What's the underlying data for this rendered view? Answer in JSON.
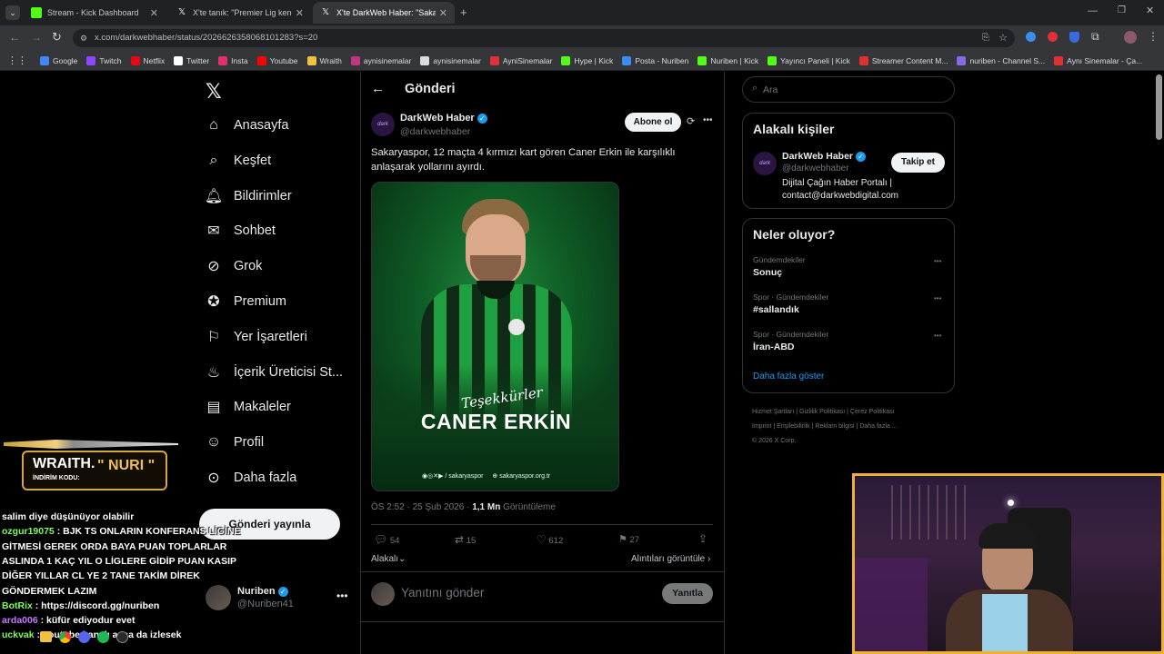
{
  "browser": {
    "tabs": [
      {
        "title": "Stream - Kick Dashboard",
        "active": false
      },
      {
        "title": "X'te tanık: \"Premier Lig kendi y",
        "active": false
      },
      {
        "title": "X'te DarkWeb Haber: \"Sakarya",
        "active": true
      }
    ],
    "url": "x.com/darkwebhaber/status/2026626358068101283?s=20",
    "bookmarks": [
      "Google",
      "Twitch",
      "Netflix",
      "Twitter",
      "Insta",
      "Youtube",
      "Wraith",
      "aynisinemalar",
      "aynisinemalar",
      "AyniSinemalar",
      "Hype | Kick",
      "Posta - Nuriben",
      "Nuriben | Kick",
      "Yayıncı Paneli | Kick",
      "Streamer Content M...",
      "nuriben - Channel S...",
      "Aynı Sinemalar - Ça..."
    ]
  },
  "sidebar": {
    "items": [
      {
        "label": "Anasayfa",
        "icon": "home-icon"
      },
      {
        "label": "Keşfet",
        "icon": "search-icon"
      },
      {
        "label": "Bildirimler",
        "icon": "bell-icon"
      },
      {
        "label": "Sohbet",
        "icon": "mail-icon"
      },
      {
        "label": "Grok",
        "icon": "grok-icon"
      },
      {
        "label": "Premium",
        "icon": "premium-icon"
      },
      {
        "label": "Yer İşaretleri",
        "icon": "bookmark-icon"
      },
      {
        "label": "İçerik Üreticisi St...",
        "icon": "creator-icon"
      },
      {
        "label": "Makaleler",
        "icon": "article-icon"
      },
      {
        "label": "Profil",
        "icon": "profile-icon"
      },
      {
        "label": "Daha fazla",
        "icon": "more-circle-icon"
      }
    ],
    "post_button": "Gönderi yayınla",
    "account": {
      "name": "Nuriben",
      "handle": "@Nuriben41"
    }
  },
  "post": {
    "header": "Gönderi",
    "author_name": "DarkWeb Haber",
    "author_handle": "@darkwebhaber",
    "subscribe_label": "Abone ol",
    "text": "Sakaryaspor, 12 maçta 4 kırmızı kart gören Caner Erkin ile karşılıklı anlaşarak yollarını ayırdı.",
    "image_script": "Teşekkürler",
    "image_name": "CANER ERKİN",
    "image_footer_left": "/ sakaryaspor",
    "image_footer_right": "sakaryaspor.org.tr",
    "timestamp": "ÖS 2:52 · 25 Şub 2026 ·",
    "views": "1,1 Mn",
    "views_label": "Görüntüleme",
    "stats": {
      "replies": "54",
      "reposts": "15",
      "likes": "612",
      "bookmarks": "27"
    },
    "sort_label": "Alakalı",
    "quotes_label": "Alıntıları görüntüle",
    "reply_placeholder": "Yanıtını gönder",
    "reply_button": "Yanıtla"
  },
  "right": {
    "search_placeholder": "Ara",
    "related_title": "Alakalı kişiler",
    "related_person": {
      "name": "DarkWeb Haber",
      "handle": "@darkwebhaber",
      "bio": "Dijital Çağın Haber Portalı | contact@darkwebdigital.com",
      "follow": "Takip et"
    },
    "trends_title": "Neler oluyor?",
    "trends": [
      {
        "context": "Gündemdekiler",
        "name": "Sonuç"
      },
      {
        "context": "Spor · Gündemdekiler",
        "name": "#sallandık"
      },
      {
        "context": "Spor · Gündemdekiler",
        "name": "İran-ABD"
      }
    ],
    "show_more": "Daha fazla göster",
    "footer_row1": [
      "Hizmet Şartları",
      "Gizlilik Politikası",
      "Çerez Politikası"
    ],
    "footer_row2": [
      "Imprint",
      "Erişilebilirlik",
      "Reklam bilgisi",
      "Daha fazla ..."
    ],
    "copyright": "© 2026 X Corp."
  },
  "overlay": {
    "sponsor_brand": "WRAITH.",
    "sponsor_code_label": "İNDİRİM KODU:",
    "sponsor_code": "\" NURI \"",
    "chat": [
      {
        "user": "",
        "text": "salim diye düşünüyor olabilir",
        "color": "#ffffff"
      },
      {
        "user": "ozgur19075",
        "text": " : BJK TS ONLARIN KONFERANS LİGİNE",
        "color": "#7cfc5a"
      },
      {
        "user": "",
        "text": "GİTMESİ GEREK ORDA BAYA PUAN TOPLARLAR",
        "color": "#ffffff"
      },
      {
        "user": "",
        "text": "ASLINDA 1 KAÇ YIL O LİGLERE GİDİP PUAN KASIP",
        "color": "#ffffff"
      },
      {
        "user": "",
        "text": "DİĞER YILLAR CL YE 2 TANE TAKİM DİREK",
        "color": "#ffffff"
      },
      {
        "user": "",
        "text": "GÖNDERMEK LAZIM",
        "color": "#ffffff"
      },
      {
        "user": "BotRix",
        "text": " : https://discord.gg/nuriben",
        "color": "#7cfc5a"
      },
      {
        "user": "arda006",
        "text": " : küfür ediyodur evet",
        "color": "#c87aff"
      },
      {
        "user": "uckvak",
        "text": " : Youtube kanalı açsa da izlesek",
        "color": "#7cfc5a"
      }
    ]
  }
}
